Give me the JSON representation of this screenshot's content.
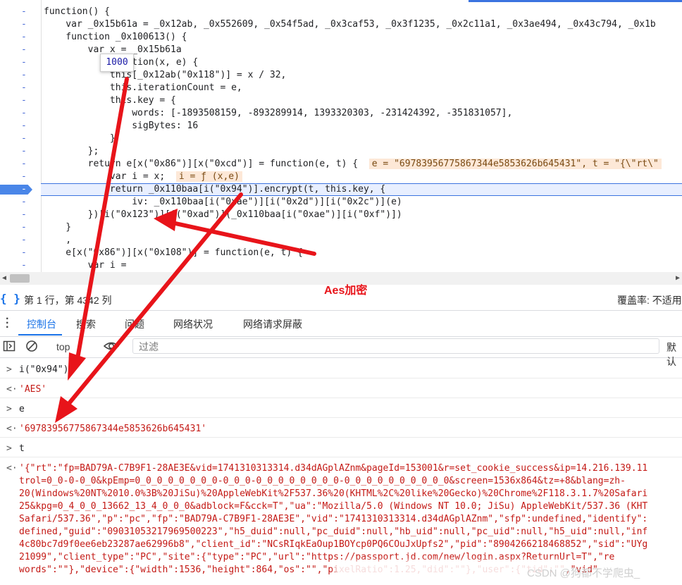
{
  "editor": {
    "lines": [
      {
        "text": "function() {"
      },
      {
        "text": "    var _0x15b61a = _0x12ab, _0x552609, _0x54f5ad, _0x3caf53, _0x3f1235, _0x2c11a1, _0x3ae494, _0x43c794, _0x1b"
      },
      {
        "text": "    function _0x100613() {"
      },
      {
        "text": "        var x = _0x15b61a"
      },
      {
        "text": "            function(x, e) {"
      },
      {
        "text": "            this[_0x12ab(\"0x118\")] = x / 32,"
      },
      {
        "text": "            this.iterationCount = e,"
      },
      {
        "text": "            this.key = {"
      },
      {
        "text": "                words: [-1893508159, -893289914, 1393320303, -231424392, -351831057],"
      },
      {
        "text": "                sigBytes: 16"
      },
      {
        "text": "            }"
      },
      {
        "text": "        };"
      },
      {
        "text": "        return e[x(\"0x86\")][x(\"0xcd\")] = function(e, t) {"
      },
      {
        "text": "            var i = x;"
      },
      {
        "text": "            return _0x110baa[i(\"0x94\")].encrypt(t, this.key, {"
      },
      {
        "text": "                iv: _0x110baa[i(\"0xae\")][i(\"0x2d\")][i(\"0x2c\")](e)"
      },
      {
        "text": "        })[i(\"0x123\")][i(\"0xad\")](_0x110baa[i(\"0xae\")][i(\"0xf\")])"
      },
      {
        "text": "    }"
      },
      {
        "text": "    ,"
      },
      {
        "text": "    e[x(\"0x86\")][x(\"0x108\")] = function(e, t) {"
      },
      {
        "text": "        var i ="
      }
    ],
    "inline_values": {
      "return_line": "e = \"69783956775867344e5853626b645431\", t = \"{\\\"rt\\\"",
      "var_line": "i = ƒ (x,e)"
    },
    "tooltip": "1000",
    "breakpoint_line": "-",
    "gutter_mark": "-"
  },
  "status": {
    "braces": "{ }",
    "position": "第 1 行，第 4342 列",
    "coverage": "覆盖率: 不适用"
  },
  "annotation": "Aes加密",
  "tabs": {
    "items": [
      "控制台",
      "搜索",
      "问题",
      "网络状况",
      "网络请求屏蔽"
    ],
    "active": "控制台"
  },
  "toolbar": {
    "context": "top",
    "filter_placeholder": "过滤",
    "default_levels": "默认"
  },
  "console": {
    "entries": [
      {
        "type": "input",
        "text": "i(\"0x94\")"
      },
      {
        "type": "result",
        "text": "'AES'"
      },
      {
        "type": "input",
        "text": "e"
      },
      {
        "type": "result",
        "text": "'69783956775867344e5853626b645431'"
      },
      {
        "type": "input",
        "text": "t"
      }
    ],
    "json_lines": [
      "'{\"rt\":\"fp=BAD79A-C7B9F1-28AE3E&vid=1741310313314.d34dAGplAZnm&pageId=153001&r=set_cookie_success&ip=14.216.139.11",
      "trol=0_0-0-0_0&kpEmp=0_0_0_0_0_0_0_0-0_0_0-0_0_0_0_0_0_0_0-0_0_0_0_0_0_0_0_0_0&screen=1536x864&tz=+8&blang=zh-",
      "20(Windows%20NT%2010.0%3B%20JiSu)%20AppleWebKit%2F537.36%20(KHTML%2C%20like%20Gecko)%20Chrome%2F118.3.1.7%20Safari",
      "25&kpg=0_4_0_0_13662_13_4_0_0_0&adblock=F&cck=T\",\"ua\":\"Mozilla/5.0 (Windows NT 10.0; JiSu) AppleWebKit/537.36 (KHT",
      "Safari/537.36\",\"p\":\"pc\",\"fp\":\"BAD79A-C7B9F1-28AE3E\",\"vid\":\"1741310313314.d34dAGplAZnm\",\"sfp\":undefined,\"identify\":",
      "defined,\"guid\":\"09031053217969500223\",\"h5_duid\":null,\"pc_duid\":null,\"hb_uid\":null,\"pc_uid\":null,\"h5_uid\":null,\"inf",
      "4c80bc7d9f0ee6eb23287ae62996b8\",\"client_id\":\"NCsRIqkEaOup1BOYcp0PQ6COuJxUpfs2\",\"pid\":\"8904266218468852\",\"sid\":\"UYg",
      "21099\",\"client_type\":\"PC\",\"site\":{\"type\":\"PC\",\"url\":\"https://passport.jd.com/new/login.aspx?ReturnUrl=T\",\"re",
      "words\":\"\"},\"device\":{\"width\":1536,\"height\":864,\"os\":\"\",\"pixelRatio\":1.25,\"did\":\"\"},\"user\":{\"tid\":\"\",\"vid\""
    ]
  },
  "watermark": "CSDN @狗都不学爬虫_",
  "colors": {
    "accent": "#1a73e8",
    "arrow": "#e8141a",
    "string": "#c41a16",
    "keyword": "#1a1aa6"
  }
}
